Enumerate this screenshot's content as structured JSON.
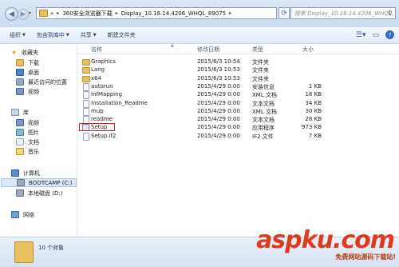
{
  "address_bar": {
    "breadcrumbs": [
      "«",
      "360安全浏览器下载",
      "Display_10.18.14.4206_WHQL_89075"
    ],
    "search_placeholder": "搜索 Display_10.18.14.4206_WHQL..."
  },
  "toolbar": {
    "items": [
      "组织",
      "包含到库中",
      "共享",
      "新建文件夹"
    ]
  },
  "nav": {
    "favorites": {
      "label": "收藏夹",
      "items": [
        "下载",
        "桌面",
        "最近访问的位置",
        "视频"
      ]
    },
    "library": {
      "label": "库",
      "items": [
        "视频",
        "图片",
        "文档",
        "音乐"
      ]
    },
    "computer": {
      "label": "计算机",
      "items": [
        "BOOTCAMP (C:)",
        "本地磁盘 (D:)"
      ]
    },
    "network": {
      "label": "网络"
    }
  },
  "columns": [
    "名称",
    "修改日期",
    "类型",
    "大小"
  ],
  "files": [
    {
      "name": "Graphics",
      "date": "2015/6/3 10:54",
      "type": "文件夹",
      "size": "",
      "icon": "folder"
    },
    {
      "name": "Lang",
      "date": "2015/6/3 10:53",
      "type": "文件夹",
      "size": "",
      "icon": "folder"
    },
    {
      "name": "x64",
      "date": "2015/6/3 10:53",
      "type": "文件夹",
      "size": "",
      "icon": "folder"
    },
    {
      "name": "autorun",
      "date": "2015/4/29 0:00",
      "type": "安装信息",
      "size": "1 KB",
      "icon": "file"
    },
    {
      "name": "InfMapping",
      "date": "2015/4/29 0:00",
      "type": "XML 文档",
      "size": "18 KB",
      "icon": "file"
    },
    {
      "name": "Installation_Readme",
      "date": "2015/4/29 0:00",
      "type": "文本文档",
      "size": "34 KB",
      "icon": "file"
    },
    {
      "name": "mup",
      "date": "2015/4/29 0:00",
      "type": "XML 文档",
      "size": "30 KB",
      "icon": "file"
    },
    {
      "name": "readme",
      "date": "2015/4/29 0:00",
      "type": "文本文档",
      "size": "28 KB",
      "icon": "file"
    },
    {
      "name": "Setup",
      "date": "2015/4/29 0:00",
      "type": "应用程序",
      "size": "973 KB",
      "icon": "app"
    },
    {
      "name": "Setup.if2",
      "date": "2015/4/29 0:00",
      "type": "IF2 文件",
      "size": "7 KB",
      "icon": "file"
    }
  ],
  "status": {
    "count": "10 个对象"
  },
  "watermark": {
    "logo": "aspku.com",
    "tagline": "免费网站源码下载站!"
  },
  "colors": {
    "highlight_box": "#e02020",
    "watermark": "#e03a1e"
  }
}
